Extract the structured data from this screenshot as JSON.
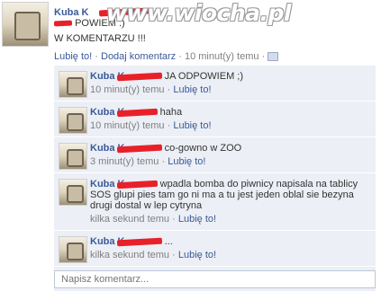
{
  "post": {
    "author": "Kuba K",
    "line1": "POWIEM :)",
    "line2": "W KOMENTARZU !!!",
    "actions": {
      "like": "Lubię to!",
      "sep1": "·",
      "comment": "Dodaj komentarz",
      "sep2": "·",
      "time": "10 minut(y) temu",
      "sep3": "·"
    }
  },
  "watermark": "www.wiocha.pl",
  "comments": [
    {
      "author": "Kuba K",
      "text": "JA ODPOWIEM ;)",
      "time": "10 minut(y) temu",
      "sep": "·",
      "like": "Lubię to!"
    },
    {
      "author": "Kuba K",
      "text": "haha",
      "time": "10 minut(y) temu",
      "sep": "·",
      "like": "Lubię to!"
    },
    {
      "author": "Kuba K",
      "text": "co-gowno w ZOO",
      "time": "3 minut(y) temu",
      "sep": "·",
      "like": "Lubię to!"
    },
    {
      "author": "Kuba K",
      "text": "wpadla bomba do piwnicy napisala na tablicy SOS glupi pies tam go ni ma a tu jest jeden oblal sie bezyna drugi dostal w lep cytryna",
      "time": "kilka sekund temu",
      "sep": "·",
      "like": "Lubię to!"
    },
    {
      "author": "Kuba K",
      "text": "...",
      "time": "kilka sekund temu",
      "sep": "·",
      "like": "Lubię to!"
    }
  ],
  "comment_input": {
    "placeholder": "Napisz komentarz..."
  },
  "colors": {
    "link": "#3b5998",
    "comment_bg": "#eceff5",
    "redaction": "#e8202a"
  }
}
